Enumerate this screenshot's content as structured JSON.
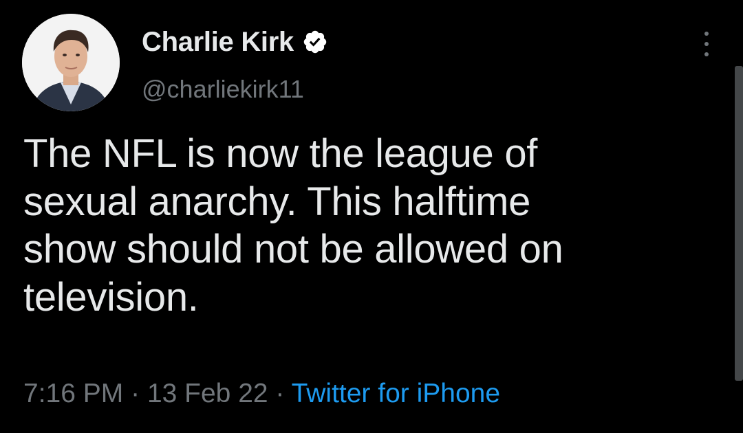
{
  "author": {
    "name": "Charlie Kirk",
    "handle": "@charliekirk11",
    "verified": true,
    "avatar_icon": "profile-photo"
  },
  "tweet": {
    "text": "The NFL is now the league of\nsexual anarchy. This halftime\nshow should not be allowed on\ntelevision.",
    "time": "7:16 PM",
    "date": "13 Feb 22",
    "separator": "·",
    "source": "Twitter for iPhone"
  },
  "colors": {
    "background": "#000000",
    "text": "#e7e9ea",
    "muted": "#71767b",
    "link": "#1d9bf0",
    "verified": "#ffffff"
  },
  "icons": {
    "more": "more-vertical-icon",
    "verified": "verified-badge-icon"
  }
}
